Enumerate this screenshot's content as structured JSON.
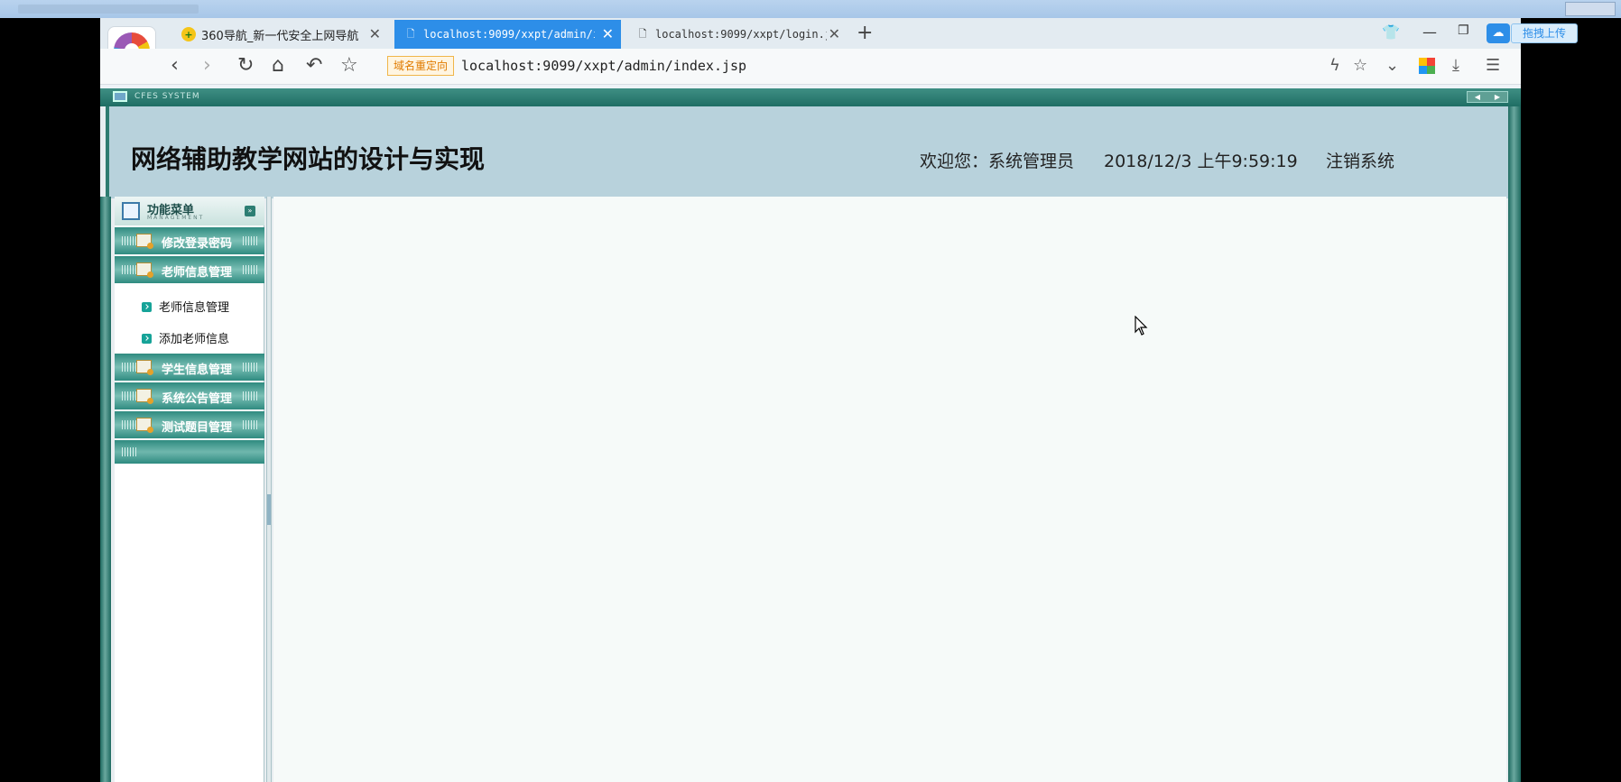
{
  "browser": {
    "tabs": [
      {
        "label": "360导航_新一代安全上网导航",
        "active": false
      },
      {
        "label": "localhost:9099/xxpt/admin/in",
        "active": true
      },
      {
        "label": "localhost:9099/xxpt/login.js",
        "active": false
      }
    ],
    "new_tab": "+",
    "upload_label": "拖拽上传",
    "redirect_label": "域名重定向",
    "url": "localhost:9099/xxpt/admin/index.jsp"
  },
  "app": {
    "system_label": "CFES SYSTEM",
    "site_title": "网络辅助教学网站的设计与实现",
    "welcome": "欢迎您：系统管理员",
    "datetime": "2018/12/3 上午9:59:19",
    "logout": "注销系统"
  },
  "sidebar": {
    "title": "功能菜单",
    "subtitle": "MANAGEMENT",
    "items": [
      {
        "label": "修改登录密码"
      },
      {
        "label": "老师信息管理"
      },
      {
        "label": "学生信息管理"
      },
      {
        "label": "系统公告管理"
      },
      {
        "label": "测试题目管理"
      }
    ],
    "subitems": [
      {
        "label": "老师信息管理"
      },
      {
        "label": "添加老师信息"
      }
    ]
  },
  "colors": {
    "accent": "#2d8ee8",
    "menu_teal": "#2f8b80",
    "header_bg": "#b8d2dc"
  }
}
